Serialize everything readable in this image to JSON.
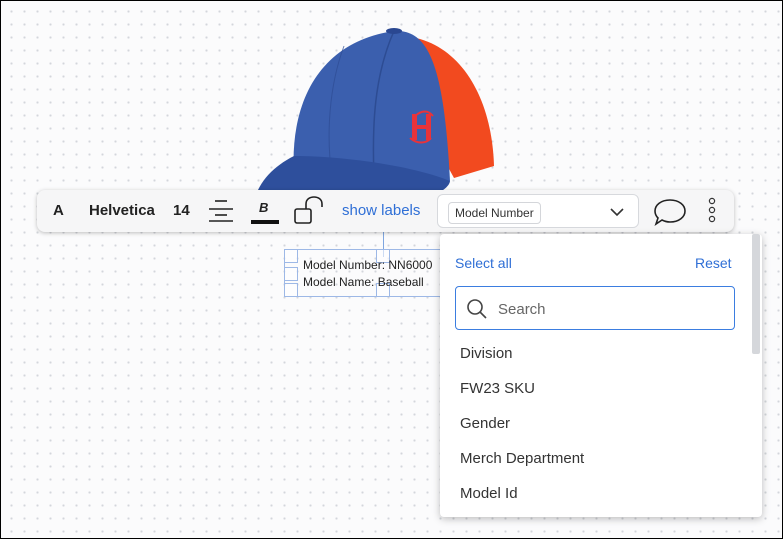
{
  "toolbar": {
    "font_style_label": "A",
    "font_family": "Helvetica",
    "font_size": "14",
    "align_icon": "align-center-icon",
    "text_color_icon": "bold-text-color-icon",
    "lock_icon": "unlock-icon",
    "show_labels": "show labels",
    "select_value": "Model Number",
    "comment_icon": "comment-icon",
    "more_icon": "more-vertical-icon"
  },
  "label": {
    "line1": "Model Number: NN6000",
    "line2": "Model Name: Baseball"
  },
  "dropdown": {
    "select_all": "Select all",
    "reset": "Reset",
    "search_placeholder": "Search",
    "options": [
      "Division",
      "FW23 SKU",
      "Gender",
      "Merch Department",
      "Model Id"
    ]
  },
  "colors": {
    "accent": "#2f6fd6",
    "cap_blue": "#3b5fae",
    "cap_orange": "#f24a1f"
  }
}
